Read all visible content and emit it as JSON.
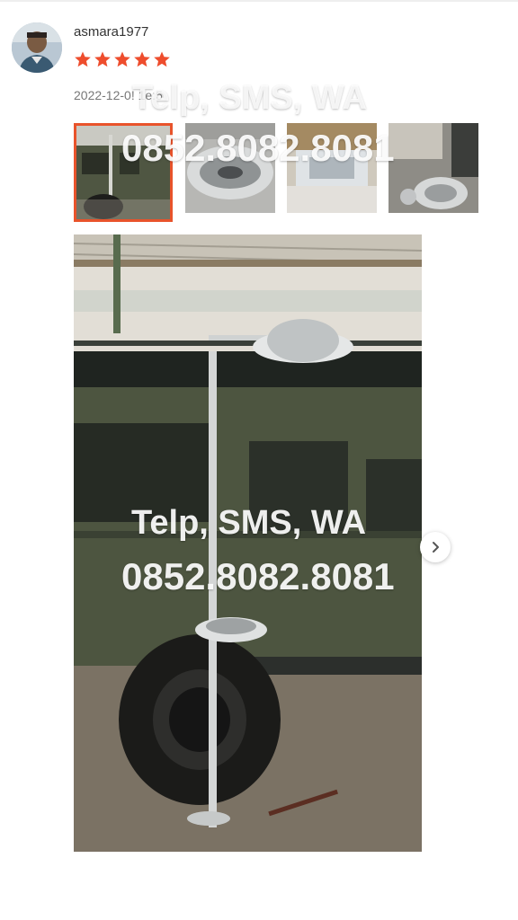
{
  "review": {
    "username": "asmara1977",
    "rating": 5,
    "rating_max": 5,
    "date": "2022-12-0",
    "date_obscured_tail": "! 1e:5"
  },
  "watermark": {
    "line1": "Telp, SMS, WA",
    "line2": "0852.8082.8081"
  },
  "gallery": {
    "thumbnail_count": 4,
    "selected_index": 0,
    "next_icon": "chevron-right-icon"
  },
  "colors": {
    "star": "#ee4d2d",
    "active_border": "#e8532b"
  }
}
